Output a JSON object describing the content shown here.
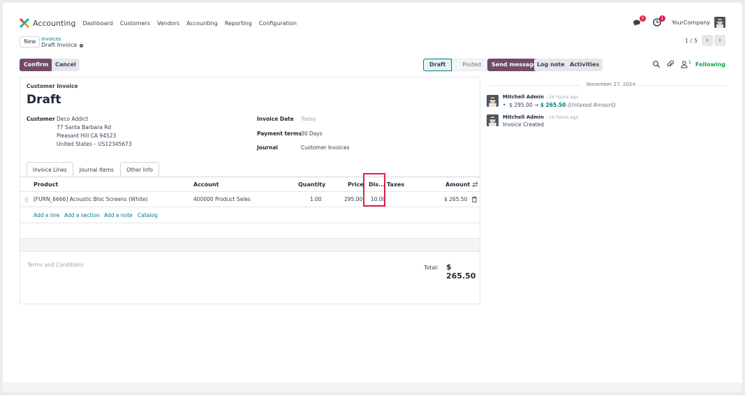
{
  "app": {
    "title": "Accounting",
    "nav": [
      "Dashboard",
      "Customers",
      "Vendors",
      "Accounting",
      "Reporting",
      "Configuration"
    ],
    "company": "YourCompany",
    "badges": {
      "messages": "5",
      "activities": "1"
    },
    "accent": "#714b67",
    "link_color": "#017e84"
  },
  "breadcrumb": {
    "new_label": "New",
    "parent": "Invoices",
    "current": "Draft Invoice"
  },
  "pager": {
    "text": "1 / 5"
  },
  "actions": {
    "confirm": "Confirm",
    "cancel": "Cancel"
  },
  "status": {
    "draft": "Draft",
    "posted": "Posted"
  },
  "chatter": {
    "send_message": "Send message",
    "log_note": "Log note",
    "activities": "Activities",
    "follower_count": "1",
    "following": "Following",
    "date": "November 27, 2024",
    "messages": [
      {
        "author": "Mitchell Admin",
        "time": "- 16 hours ago",
        "old_value": "$ 295.00",
        "arrow": "→",
        "new_value": "$ 265.50",
        "field": "(Untaxed Amount)"
      },
      {
        "author": "Mitchell Admin",
        "time": "- 16 hours ago",
        "body": "Invoice Created"
      }
    ]
  },
  "invoice": {
    "type": "Customer Invoice",
    "state": "Draft",
    "customer_label": "Customer",
    "customer": "Deco Addict",
    "address1": "77 Santa Barbara Rd",
    "address2": "Pleasant Hill CA 94523",
    "address3": "United States – US12345673",
    "invoice_date_label": "Invoice Date",
    "invoice_date": "Today",
    "payment_terms_label": "Payment terms",
    "payment_terms": "30 Days",
    "journal_label": "Journal",
    "journal": "Customer Invoices"
  },
  "tabs": [
    "Invoice Lines",
    "Journal Items",
    "Other Info"
  ],
  "lines": {
    "headers": {
      "product": "Product",
      "account": "Account",
      "quantity": "Quantity",
      "price": "Price",
      "discount": "Dis...",
      "taxes": "Taxes",
      "amount": "Amount"
    },
    "rows": [
      {
        "product": "[FURN_6666] Acoustic Bloc Screens (White)",
        "account": "400000 Product Sales",
        "quantity": "1.00",
        "price": "295.00",
        "discount": "10.00",
        "taxes": "",
        "amount": "$ 265.50"
      }
    ],
    "add_line": "Add a line",
    "add_section": "Add a section",
    "add_note": "Add a note",
    "catalog": "Catalog"
  },
  "footer": {
    "terms_placeholder": "Terms and Conditions",
    "total_label": "Total:",
    "total_value": "$ 265.50"
  }
}
